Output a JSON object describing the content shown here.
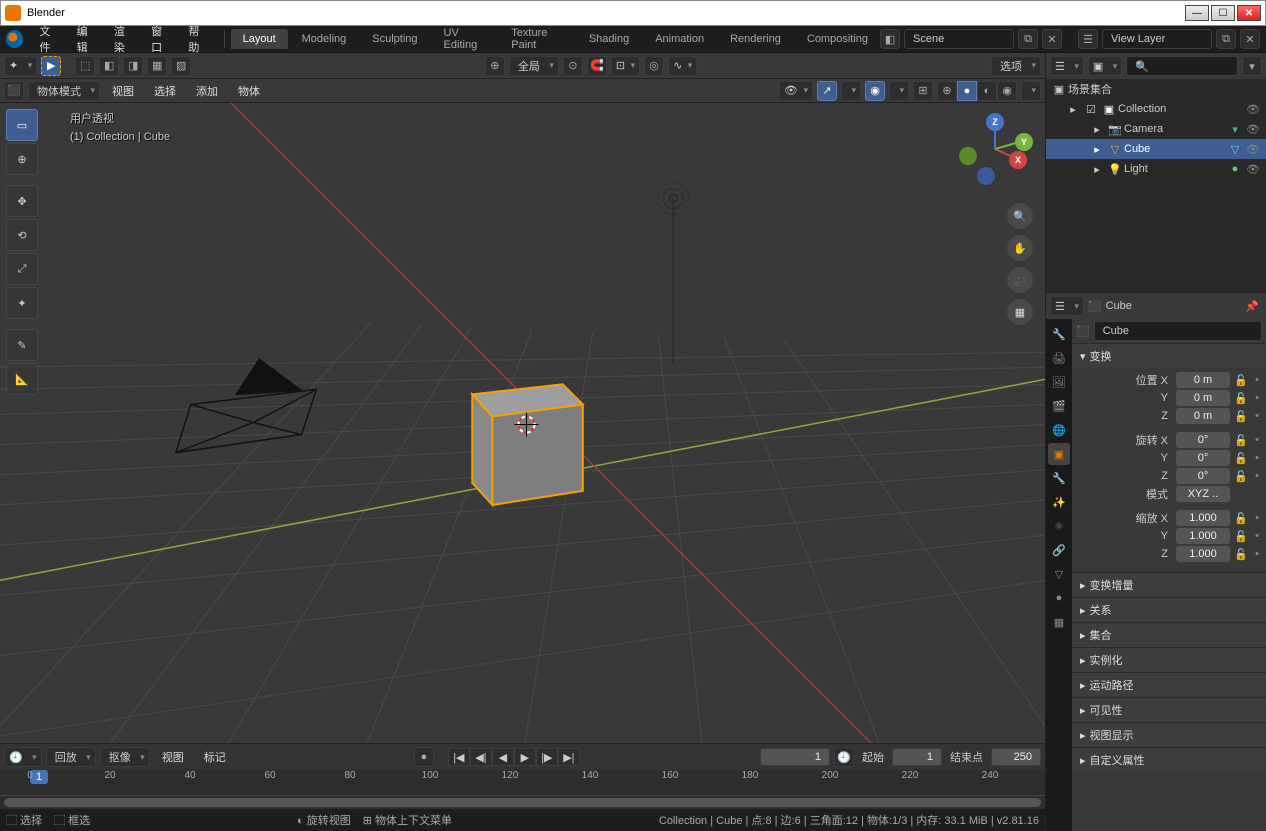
{
  "window": {
    "title": "Blender"
  },
  "topmenu": [
    "文件",
    "编辑",
    "渲染",
    "窗口",
    "帮助"
  ],
  "tabs": [
    "Layout",
    "Modeling",
    "Sculpting",
    "UV Editing",
    "Texture Paint",
    "Shading",
    "Animation",
    "Rendering",
    "Compositing"
  ],
  "active_tab": 0,
  "scene": {
    "label": "Scene",
    "layer": "View Layer"
  },
  "vpheader": {
    "orient_label": "全局",
    "options": "选项"
  },
  "vpheader2": {
    "mode": "物体模式",
    "m1": "视图",
    "m2": "选择",
    "m3": "添加",
    "m4": "物体"
  },
  "overlay": {
    "l1": "用户透视",
    "l2": "(1) Collection | Cube"
  },
  "tlhead": {
    "playback": "回放",
    "keying": "抠像",
    "view": "视图",
    "mark": "标记",
    "cur": "1",
    "start_l": "起始",
    "start": "1",
    "end_l": "结束点",
    "end": "250"
  },
  "tl_ticks": [
    "0",
    "20",
    "40",
    "60",
    "80",
    "100",
    "120",
    "140",
    "160",
    "180",
    "200",
    "220",
    "240"
  ],
  "status_left": [
    [
      "⬚",
      "选择"
    ],
    [
      "⬚",
      "框选"
    ]
  ],
  "status_mid": [
    [
      "◐",
      "旋转视图"
    ],
    [
      "⊞",
      "物体上下文菜单"
    ]
  ],
  "status_right": "Collection | Cube | 点:8 | 边:6 | 三角面:12 | 物体:1/3 | 内存: 33.1 MiB | v2.81.16",
  "outliner": {
    "root": "场景集合",
    "items": [
      {
        "indent": 1,
        "icon": "▣",
        "name": "Collection",
        "ex": true,
        "chk": true
      },
      {
        "indent": 2,
        "icon": "📷",
        "name": "Camera",
        "color": "#e9a44a"
      },
      {
        "indent": 2,
        "icon": "▽",
        "name": "Cube",
        "color": "#e9a44a",
        "sel": true
      },
      {
        "indent": 2,
        "icon": "💡",
        "name": "Light",
        "color": "#e9a44a"
      }
    ]
  },
  "props": {
    "crumb": "Cube",
    "name": "Cube",
    "panels": {
      "transform": {
        "title": "变换",
        "loc": "位置",
        "locv": [
          "0 m",
          "0 m",
          "0 m"
        ],
        "rot": "旋转",
        "rotv": [
          "0°",
          "0°",
          "0°"
        ],
        "mode": "模式",
        "modev": "XYZ ..",
        "scale": "缩放",
        "scalev": [
          "1.000",
          "1.000",
          "1.000"
        ],
        "axes": [
          "X",
          "Y",
          "Z"
        ]
      },
      "delta": "变换增量",
      "rel": "关系",
      "col": "集合",
      "inst": "实例化",
      "mp": "运动路径",
      "vis": "可见性",
      "vd": "视图显示",
      "cust": "自定义属性"
    }
  }
}
